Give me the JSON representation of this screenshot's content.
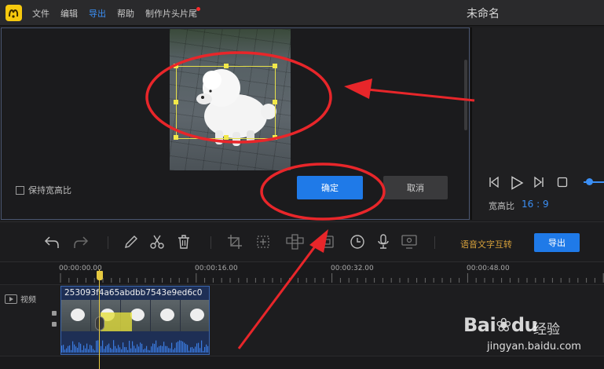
{
  "menubar": {
    "items": [
      "文件",
      "编辑",
      "导出",
      "帮助",
      "制作片头片尾"
    ],
    "active_index": 2,
    "title": "未命名"
  },
  "crop_dialog": {
    "keep_ratio_label": "保持宽高比",
    "keep_ratio_checked": false,
    "ok_label": "确定",
    "cancel_label": "取消"
  },
  "player": {
    "ratio_label": "宽高比",
    "ratio_value": "16 : 9"
  },
  "toolbar": {
    "speech_text_label": "语音文字互转",
    "export_label": "导出"
  },
  "timeline": {
    "ticks": [
      "00:00:00.00",
      "00:00:16.00",
      "00:00:32.00",
      "00:00:48.00"
    ],
    "track_label": "视频",
    "clip_name": "253093f4a65abdbb7543e9ed6c0"
  },
  "watermark": {
    "brand": "Bai",
    "brand_suffix": "du",
    "cn": "经验",
    "url": "jingyan.baidu.com"
  },
  "colors": {
    "accent": "#1f7ae8",
    "selection": "#e6e04a",
    "annotation": "#e8262a",
    "playhead": "#e6c940"
  }
}
